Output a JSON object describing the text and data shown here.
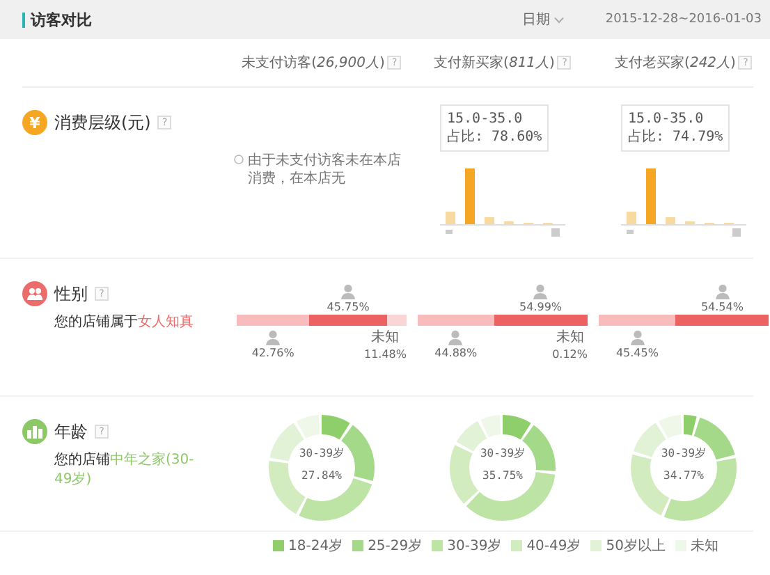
{
  "header": {
    "title": "访客对比",
    "date_label": "日期",
    "date_range": "2015-12-28~2016-01-03"
  },
  "columns": [
    {
      "label": "未支付访客(*26,900人*)",
      "help": "?"
    },
    {
      "label": "支付新买家(*811人*)",
      "help": "?"
    },
    {
      "label": "支付老买家(*242人*)",
      "help": "?"
    }
  ],
  "spending": {
    "icon": "¥",
    "title": "消费层级(元)",
    "help": "?",
    "cells": [
      {
        "kind": "note",
        "text": "由于未支付访客未在本店消费，在本店无"
      },
      {
        "kind": "histogram",
        "tooltip_range": "15.0-35.0",
        "tooltip_share": "占比: 78.60%"
      },
      {
        "kind": "histogram",
        "tooltip_range": "15.0-35.0",
        "tooltip_share": "占比: 74.79%"
      }
    ]
  },
  "gender": {
    "title": "性别",
    "help": "?",
    "summary": "您的店铺属于**女人知真**",
    "cells": [
      {
        "female": {
          "share": "45.75%",
          "level": 0.4575
        },
        "male": {
          "share": "42.76%",
          "level": 0.4276
        },
        "unknown": {
          "label": "未知",
          "share": "11.48%"
        }
      },
      {
        "female": {
          "share": "54.99%",
          "level": 0.5499
        },
        "male": {
          "share": "44.88%",
          "level": 0.4488
        },
        "unknown": {
          "label": "未知",
          "share": "0.12%"
        }
      },
      {
        "female": {
          "share": "54.54%",
          "level": 0.5454
        },
        "male": {
          "share": "45.45%",
          "level": 0.4545
        }
      }
    ]
  },
  "age": {
    "title": "年龄",
    "help": "?",
    "summary": "您的店铺**中年之家(30-49岁)**",
    "cells": [
      {
        "center_label": "30-39岁",
        "center_share": "27.84%"
      },
      {
        "center_label": "30-39岁",
        "center_share": "35.75%"
      },
      {
        "center_label": "30-39岁",
        "center_share": "34.77%"
      }
    ],
    "legend": [
      {
        "label": "18-24岁",
        "color": "#8fcf6b"
      },
      {
        "label": "25-29岁",
        "color": "#a5d98a"
      },
      {
        "label": "30-39岁",
        "color": "#bde3a5"
      },
      {
        "label": "40-49岁",
        "color": "#d2ecc0"
      },
      {
        "label": "50岁以上",
        "color": "#e2f2d6"
      },
      {
        "label": "未知",
        "color": "#eef7e8"
      }
    ]
  }
}
